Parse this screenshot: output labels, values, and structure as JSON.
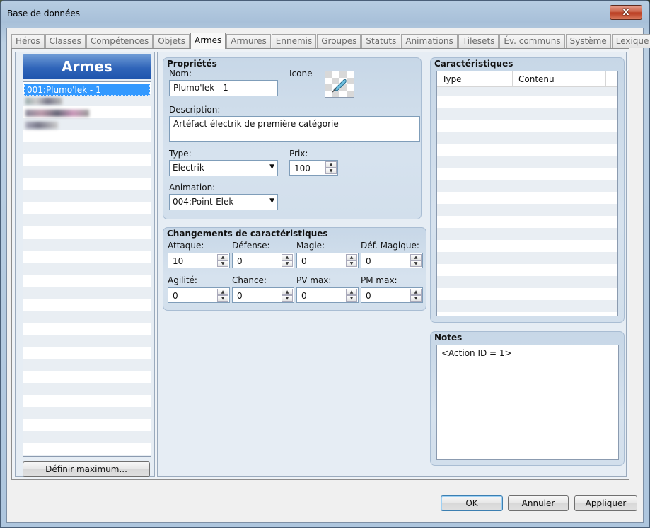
{
  "window": {
    "title": "Base de données",
    "close_label": "x"
  },
  "tabs": [
    "Héros",
    "Classes",
    "Compétences",
    "Objets",
    "Armes",
    "Armures",
    "Ennemis",
    "Groupes",
    "Statuts",
    "Animations",
    "Tilesets",
    "Év. communs",
    "Système",
    "Lexique"
  ],
  "active_tab": "Armes",
  "list": {
    "header": "Armes",
    "selected_item": "001:Plumo'lek - 1",
    "define_max_label": "Définir maximum..."
  },
  "properties": {
    "title": "Propriétés",
    "name_label": "Nom:",
    "name_value": "Plumo'lek - 1",
    "icon_label": "Icone",
    "description_label": "Description:",
    "description_value": "Artéfact électrik de première catégorie",
    "type_label": "Type:",
    "type_value": "Electrik",
    "price_label": "Prix:",
    "price_value": "100",
    "animation_label": "Animation:",
    "animation_value": "004:Point-Elek"
  },
  "stats": {
    "title": "Changements de caractéristiques",
    "items": [
      {
        "label": "Attaque:",
        "value": "10"
      },
      {
        "label": "Défense:",
        "value": "0"
      },
      {
        "label": "Magie:",
        "value": "0"
      },
      {
        "label": "Déf. Magique:",
        "value": "0"
      },
      {
        "label": "Agilité:",
        "value": "0"
      },
      {
        "label": "Chance:",
        "value": "0"
      },
      {
        "label": "PV max:",
        "value": "0"
      },
      {
        "label": "PM max:",
        "value": "0"
      }
    ]
  },
  "traits": {
    "title": "Caractéristiques",
    "col_type": "Type",
    "col_content": "Contenu"
  },
  "notes": {
    "title": "Notes",
    "value": "<Action ID = 1>"
  },
  "footer": {
    "ok_label": "OK",
    "cancel_label": "Annuler",
    "apply_label": "Appliquer"
  }
}
